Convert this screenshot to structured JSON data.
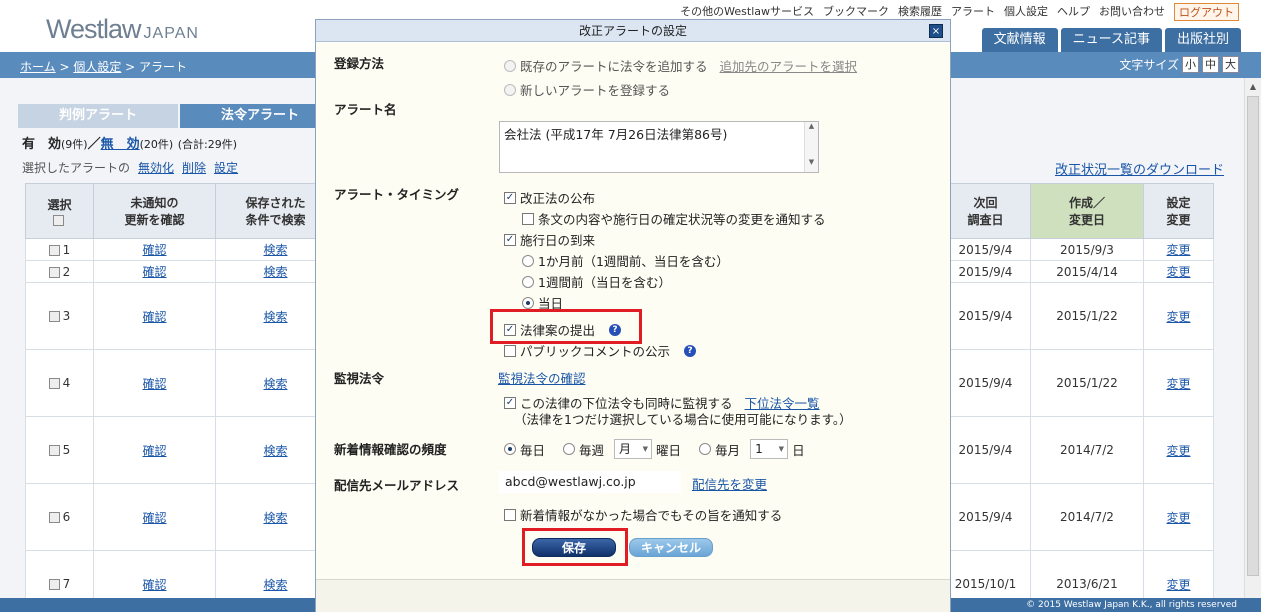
{
  "util": {
    "items": [
      "その他のWestlawサービス",
      "ブックマーク",
      "検索履歴",
      "アラート",
      "個人設定",
      "ヘルプ",
      "お問い合わせ"
    ],
    "logout": "ログアウト"
  },
  "logo": {
    "main": "Westlaw",
    "sub": "JAPAN"
  },
  "nav": {
    "tabs": [
      "文献情報",
      "ニュース記事",
      "出版社別"
    ]
  },
  "breadcrumb": {
    "home": "ホーム",
    "personal": "個人設定",
    "current": "アラート"
  },
  "font_size": {
    "label": "文字サイズ",
    "small": "小",
    "medium": "中",
    "large": "大"
  },
  "page_tabs": {
    "case": "判例アラート",
    "law": "法令アラート"
  },
  "counts": {
    "valid": "有　効",
    "valid_n": "(9件)",
    "sep": "／",
    "invalid": "無　効",
    "invalid_n": "(20件)",
    "total": "(合計:29件)"
  },
  "actions": {
    "selected": "選択したアラートの",
    "deactivate": "無効化",
    "delete": "削除",
    "settings": "設定"
  },
  "download_link": "改正状況一覧のダウンロード",
  "table": {
    "headers": {
      "select": "選択",
      "unnotified": "未通知の\n更新を確認",
      "saved": "保存された\n条件で検索",
      "next": "次回\n調査日",
      "created": "作成／\n変更日",
      "settings": "設定\n変更"
    },
    "rows": [
      {
        "num": "1",
        "confirm": "確認",
        "search": "検索",
        "next": "2015/9/4",
        "created": "2015/9/3",
        "change": "変更"
      },
      {
        "num": "2",
        "confirm": "確認",
        "search": "検索",
        "next": "2015/9/4",
        "created": "2015/4/14",
        "change": "変更"
      },
      {
        "num": "3",
        "confirm": "確認",
        "search": "検索",
        "next": "2015/9/4",
        "created": "2015/1/22",
        "change": "変更"
      },
      {
        "num": "4",
        "confirm": "確認",
        "search": "検索",
        "next": "2015/9/4",
        "created": "2015/1/22",
        "change": "変更"
      },
      {
        "num": "5",
        "confirm": "確認",
        "search": "検索",
        "next": "2015/9/4",
        "created": "2014/7/2",
        "change": "変更"
      },
      {
        "num": "6",
        "confirm": "確認",
        "search": "検索",
        "next": "2015/9/4",
        "created": "2014/7/2",
        "change": "変更"
      },
      {
        "num": "7",
        "confirm": "確認",
        "search": "検索",
        "next": "2015/10/1",
        "created": "2013/6/21",
        "change": "変更"
      }
    ]
  },
  "footer": "© 2015 Westlaw Japan K.K., all rights reserved",
  "dialog": {
    "title": "改正アラートの設定",
    "close": "×",
    "reg_label": "登録方法",
    "reg_opt1": "既存のアラートに法令を追加する",
    "reg_opt1_link": "追加先のアラートを選択",
    "reg_opt2": "新しいアラートを登録する",
    "name_label": "アラート名",
    "name_value": "会社法 (平成17年 7月26日法律第86号)",
    "timing_label": "アラート・タイミング",
    "t_kaisei": "改正法の公布",
    "t_jobun": "条文の内容や施行日の確定状況等の変更を通知する",
    "t_shiko": "施行日の到来",
    "t_1month": "1か月前（1週間前、当日を含む）",
    "t_1week": "1週間前（当日を含む）",
    "t_today": "当日",
    "t_houritsuan": "法律案の提出",
    "t_public": "パブリックコメントの公示",
    "monitor_label": "監視法令",
    "monitor_link": "監視法令の確認",
    "monitor_lower": "この法律の下位法令も同時に監視する",
    "monitor_lower_link": "下位法令一覧",
    "monitor_note": "（法律を1つだけ選択している場合に使用可能になります。）",
    "freq_label": "新着情報確認の頻度",
    "freq_daily": "毎日",
    "freq_weekly": "毎週",
    "freq_week_value": "月",
    "freq_week_suffix": "曜日",
    "freq_monthly": "毎月",
    "freq_month_value": "1",
    "freq_month_suffix": "日",
    "email_label": "配信先メールアドレス",
    "email_value": "abcd@westlawj.co.jp",
    "email_link": "配信先を変更",
    "notify_empty": "新着情報がなかった場合でもその旨を通知する",
    "save": "保存",
    "cancel": "キャンセル",
    "help": "?"
  }
}
